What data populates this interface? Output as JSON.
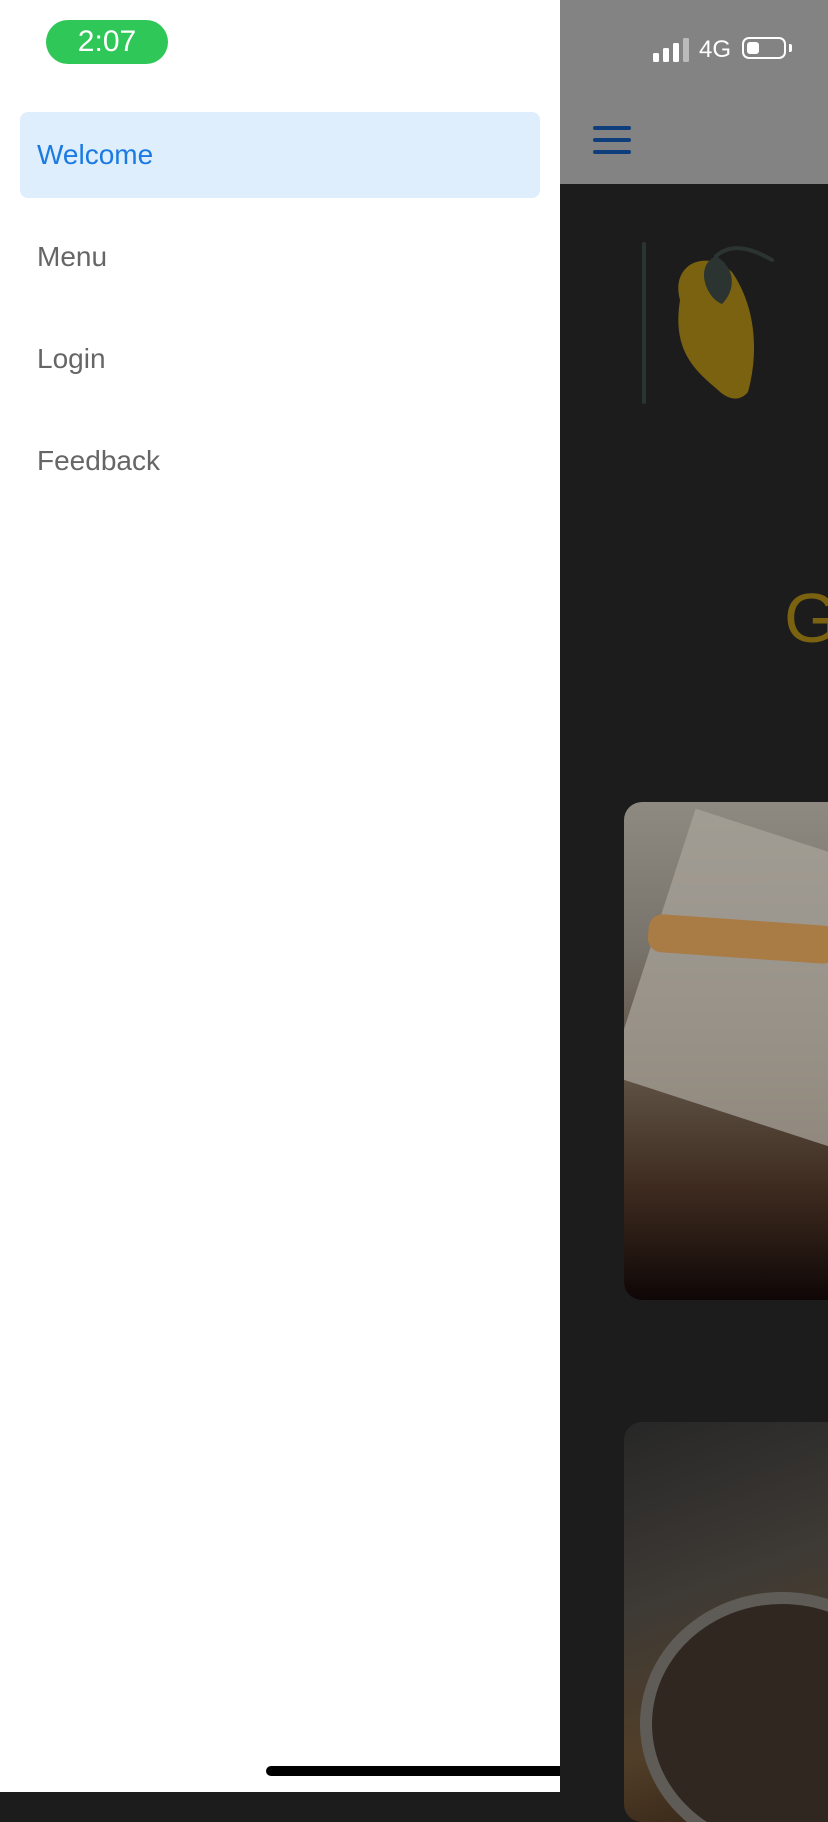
{
  "status_bar": {
    "time": "2:07",
    "network": "4G",
    "battery_level": 0.35
  },
  "drawer": {
    "items": [
      {
        "label": "Welcome",
        "active": true
      },
      {
        "label": "Menu",
        "active": false
      },
      {
        "label": "Login",
        "active": false
      },
      {
        "label": "Feedback",
        "active": false
      }
    ]
  },
  "background_screen": {
    "heading_fragment": "G"
  },
  "colors": {
    "accent": "#1a7ae2",
    "active_item_background": "#deeefc",
    "time_pill": "#30c759",
    "logo_lemon": "#7a6210"
  },
  "icons": {
    "menu": "hamburger-menu-icon",
    "logo": "lemon-logo-icon"
  }
}
